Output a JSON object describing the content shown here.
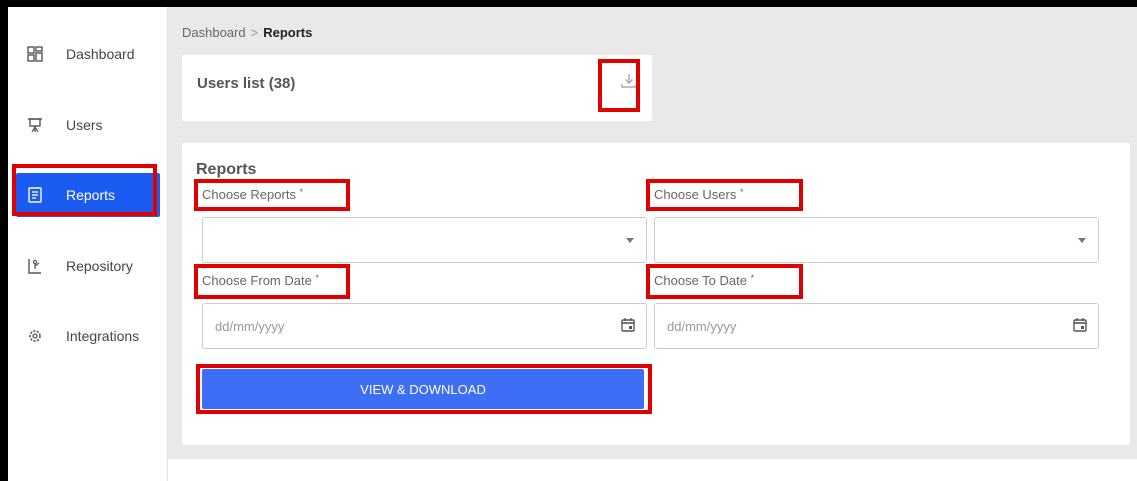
{
  "sidebar": {
    "items": [
      {
        "label": "Dashboard",
        "icon": "dashboard-icon"
      },
      {
        "label": "Users",
        "icon": "users-icon"
      },
      {
        "label": "Reports",
        "icon": "reports-icon",
        "active": true
      },
      {
        "label": "Repository",
        "icon": "repository-icon"
      },
      {
        "label": "Integrations",
        "icon": "integrations-icon"
      }
    ]
  },
  "breadcrumb": {
    "root": "Dashboard",
    "separator": ">",
    "current": "Reports"
  },
  "users_card": {
    "title": "Users list (38)",
    "download_icon": "download-icon"
  },
  "reports_form": {
    "title": "Reports",
    "choose_reports_label": "Choose Reports",
    "choose_users_label": "Choose Users",
    "from_date_label": "Choose From Date",
    "to_date_label": "Choose To Date",
    "required_mark": "*",
    "from_date_placeholder": "dd/mm/yyyy",
    "to_date_placeholder": "dd/mm/yyyy",
    "submit_label": "VIEW & DOWNLOAD"
  },
  "colors": {
    "accent": "#1a5cf2",
    "button": "#3d6ef5",
    "highlight": "#e10000"
  }
}
